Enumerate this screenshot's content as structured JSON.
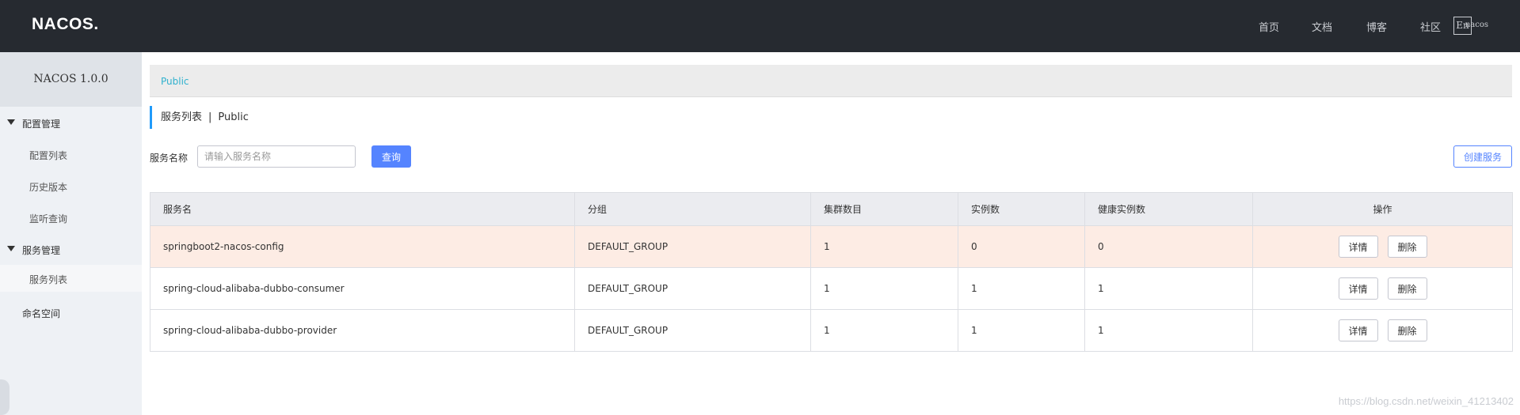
{
  "header": {
    "logo": "NACOS.",
    "nav": [
      "首页",
      "文档",
      "博客",
      "社区"
    ],
    "lang": "En",
    "user": "nacos"
  },
  "sidebar": {
    "version": "NACOS 1.0.0",
    "groups": [
      {
        "label": "配置管理",
        "items": [
          "配置列表",
          "历史版本",
          "监听查询"
        ]
      },
      {
        "label": "服务管理",
        "items": [
          "服务列表"
        ]
      }
    ],
    "namespace": "命名空间",
    "active_item": "服务列表"
  },
  "main": {
    "namespace_link": "Public",
    "title": "服务列表",
    "title_sep": "|",
    "title_ns": "Public",
    "filter_label": "服务名称",
    "search_placeholder": "请输入服务名称",
    "query_label": "查询",
    "create_label": "创建服务",
    "columns": [
      "服务名",
      "分组",
      "集群数目",
      "实例数",
      "健康实例数",
      "操作"
    ],
    "rows": [
      [
        "springboot2-nacos-config",
        "DEFAULT_GROUP",
        "1",
        "0",
        "0"
      ],
      [
        "spring-cloud-alibaba-dubbo-consumer",
        "DEFAULT_GROUP",
        "1",
        "1",
        "1"
      ],
      [
        "spring-cloud-alibaba-dubbo-provider",
        "DEFAULT_GROUP",
        "1",
        "1",
        "1"
      ]
    ],
    "detail_label": "详情",
    "delete_label": "删除"
  },
  "watermark": "https://blog.csdn.net/weixin_41213402",
  "colors": {
    "header_bg": "#262a30",
    "sidebar_bg": "#eef1f5",
    "primary": "#5584ff",
    "link": "#2fb1ce",
    "row_highlight": "#fdece4"
  }
}
